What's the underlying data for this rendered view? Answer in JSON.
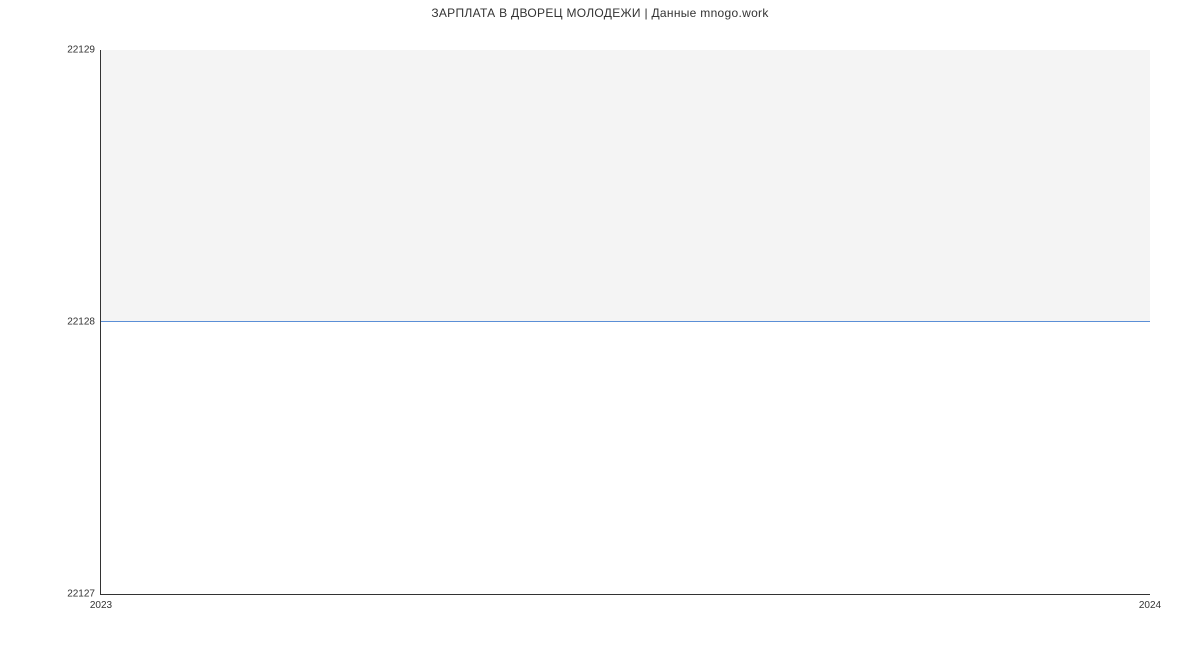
{
  "chart_data": {
    "type": "line",
    "title": "ЗАРПЛАТА В ДВОРЕЦ МОЛОДЕЖИ | Данные mnogo.work",
    "xlabel": "",
    "ylabel": "",
    "x": [
      2023,
      2024
    ],
    "values": [
      22128,
      22128
    ],
    "x_ticks": [
      "2023",
      "2024"
    ],
    "y_ticks": [
      "22127",
      "22128",
      "22129"
    ],
    "ylim": [
      22127,
      22129
    ],
    "xlim": [
      2023,
      2024
    ],
    "line_color": "#5b8fd6",
    "grid": false,
    "legend": false
  }
}
